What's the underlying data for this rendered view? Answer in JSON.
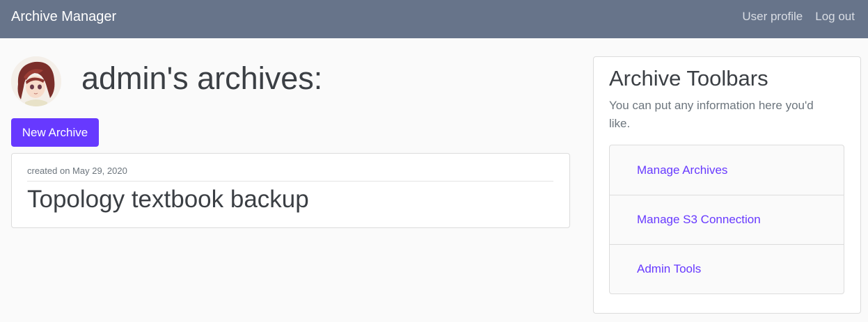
{
  "navbar": {
    "brand": "Archive Manager",
    "links": [
      "User profile",
      "Log out"
    ]
  },
  "profile": {
    "avatar_icon": "anime-avatar-icon",
    "title": "admin's archives:"
  },
  "actions": {
    "new_archive_label": "New Archive"
  },
  "archives": [
    {
      "created": "created on May 29, 2020",
      "title": "Topology textbook backup"
    }
  ],
  "sidebar": {
    "title": "Archive Toolbars",
    "description": "You can put any information here you'd like.",
    "items": [
      {
        "label": "Manage Archives"
      },
      {
        "label": "Manage S3 Connection"
      },
      {
        "label": "Admin Tools"
      }
    ]
  },
  "colors": {
    "navbar_bg": "#67748a",
    "accent": "#6739ff",
    "page_bg": "#fafafa"
  }
}
